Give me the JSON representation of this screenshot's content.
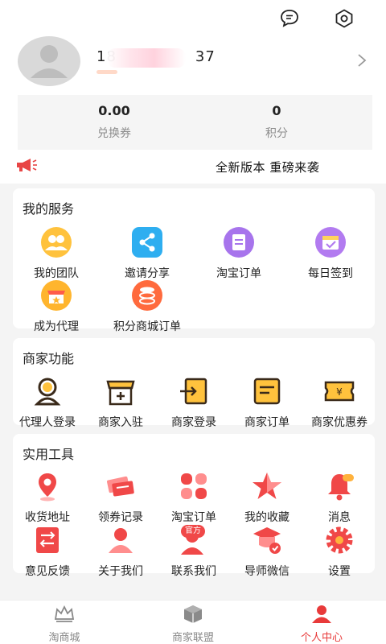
{
  "header": {
    "phone_prefix": "18",
    "phone_suffix": "37",
    "icons": [
      "chat-icon",
      "settings-hexagon-icon",
      "chevron-right-icon"
    ]
  },
  "stats": [
    {
      "value": "0.00",
      "label": "兑换券"
    },
    {
      "value": "0",
      "label": "积分"
    }
  ],
  "notice": {
    "text": "全新版本 重磅来袭"
  },
  "services": {
    "title": "我的服务",
    "items": [
      "我的团队",
      "邀请分享",
      "淘宝订单",
      "每日签到",
      "成为代理",
      "积分商城订单"
    ]
  },
  "merchant": {
    "title": "商家功能",
    "items": [
      "代理人登录",
      "商家入驻",
      "商家登录",
      "商家订单",
      "商家优惠券"
    ]
  },
  "tools": {
    "title": "实用工具",
    "items": [
      "收货地址",
      "领券记录",
      "淘宝订单",
      "我的收藏",
      "消息",
      "意见反馈",
      "关于我们",
      "联系我们",
      "导师微信",
      "设置"
    ],
    "badge": "官方"
  },
  "tabs": [
    {
      "label": "淘商城",
      "active": false
    },
    {
      "label": "商家联盟",
      "active": false
    },
    {
      "label": "个人中心",
      "active": true
    }
  ],
  "colors": {
    "accent": "#e83a3a",
    "stat_bg": "#f5f5f5",
    "page_bg": "#f4f4f4"
  }
}
